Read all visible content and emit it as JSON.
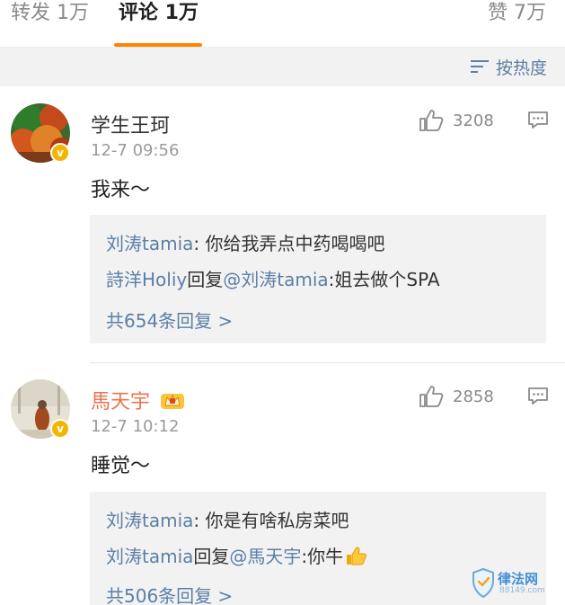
{
  "tabs": {
    "repost": "转发 1万",
    "comments": "评论 1万",
    "likes": "赞 7万"
  },
  "sort": {
    "label": "按热度"
  },
  "comments": [
    {
      "username": "学生王珂",
      "time": "12-7 09:56",
      "likes": "3208",
      "text": "我来～",
      "replies": [
        {
          "user": "刘涛tamia",
          "text": ": 你给我弄点中药喝喝吧"
        },
        {
          "user": "詩洋Holiy",
          "mid": "回复",
          "mention": "@刘涛tamia",
          "text": ":姐去做个SPA"
        }
      ],
      "more": "共654条回复 >"
    },
    {
      "username": "馬天宇",
      "time": "12-7 10:12",
      "likes": "2858",
      "text": "睡觉～",
      "replies": [
        {
          "user": "刘涛tamia",
          "text": ": 你是有啥私房菜吧"
        },
        {
          "user": "刘涛tamia",
          "mid": "回复",
          "mention": "@馬天宇",
          "text": ":你牛"
        }
      ],
      "more": "共506条回复 >"
    }
  ],
  "watermark": {
    "name": "律法网",
    "domain": "88149.com"
  },
  "colors": {
    "accent": "#ff8200",
    "link": "#5b7fa6",
    "vip_name": "#eb7350"
  }
}
